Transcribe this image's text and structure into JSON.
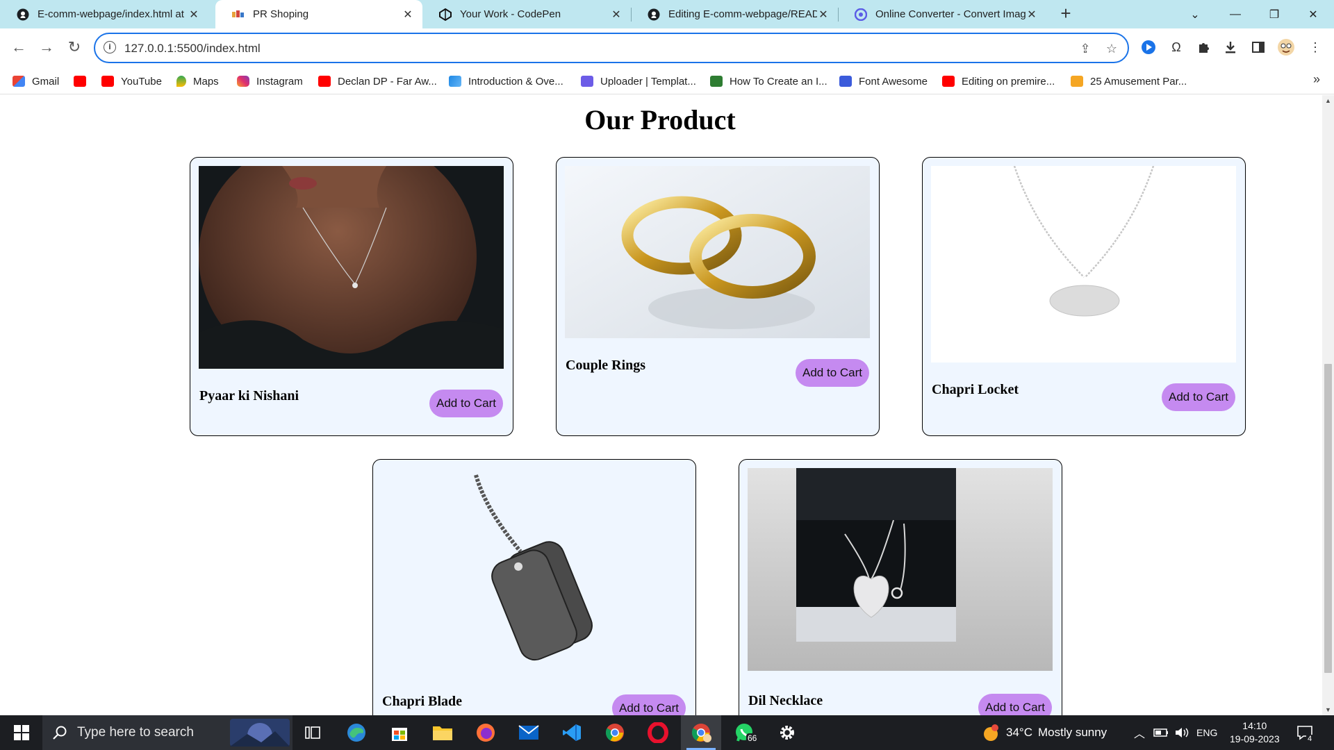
{
  "browser": {
    "tabs": [
      {
        "title": "E-comm-webpage/index.html at",
        "icon": "github-icon",
        "active": false
      },
      {
        "title": "PR Shoping",
        "icon": "site-logo-icon",
        "active": true
      },
      {
        "title": "Your Work - CodePen",
        "icon": "codepen-icon",
        "active": false
      },
      {
        "title": "Editing E-comm-webpage/READ",
        "icon": "github-icon",
        "active": false
      },
      {
        "title": "Online Converter - Convert Imag",
        "icon": "converter-icon",
        "active": false
      }
    ],
    "address": "127.0.0.1:5500/index.html",
    "bookmarks": [
      {
        "label": "Gmail",
        "icon": "gmail-icon"
      },
      {
        "label": "",
        "icon": "youtube-icon"
      },
      {
        "label": "YouTube",
        "icon": "youtube-icon"
      },
      {
        "label": "Maps",
        "icon": "maps-icon"
      },
      {
        "label": "Instagram",
        "icon": "instagram-icon"
      },
      {
        "label": "Declan DP - Far Aw...",
        "icon": "youtube-icon"
      },
      {
        "label": "Introduction & Ove...",
        "icon": "feather-icon"
      },
      {
        "label": "Uploader | Templat...",
        "icon": "uploader-icon"
      },
      {
        "label": "How To Create an I...",
        "icon": "w-logo-icon"
      },
      {
        "label": "Font Awesome",
        "icon": "flag-icon"
      },
      {
        "label": "Editing on premire...",
        "icon": "youtube-icon"
      },
      {
        "label": "25 Amusement Par...",
        "icon": "amusement-icon"
      }
    ]
  },
  "page": {
    "heading": "Our Product",
    "cart_label": "Add to Cart",
    "products": [
      {
        "name": "Pyaar ki Nishani",
        "image": "woman-necklace-photo"
      },
      {
        "name": "Couple Rings",
        "image": "gold-rings-photo"
      },
      {
        "name": "Chapri Locket",
        "image": "silver-locket-photo"
      },
      {
        "name": "Chapri Blade",
        "image": "dog-tag-photo"
      },
      {
        "name": "Dil Necklace",
        "image": "heart-necklace-photo"
      }
    ]
  },
  "taskbar": {
    "search_placeholder": "Type here to search",
    "whatsapp_badge": "66",
    "weather_temp": "34°C",
    "weather_text": "Mostly sunny",
    "language": "ENG",
    "time": "14:10",
    "date": "19-09-2023",
    "notification_count": "4"
  }
}
